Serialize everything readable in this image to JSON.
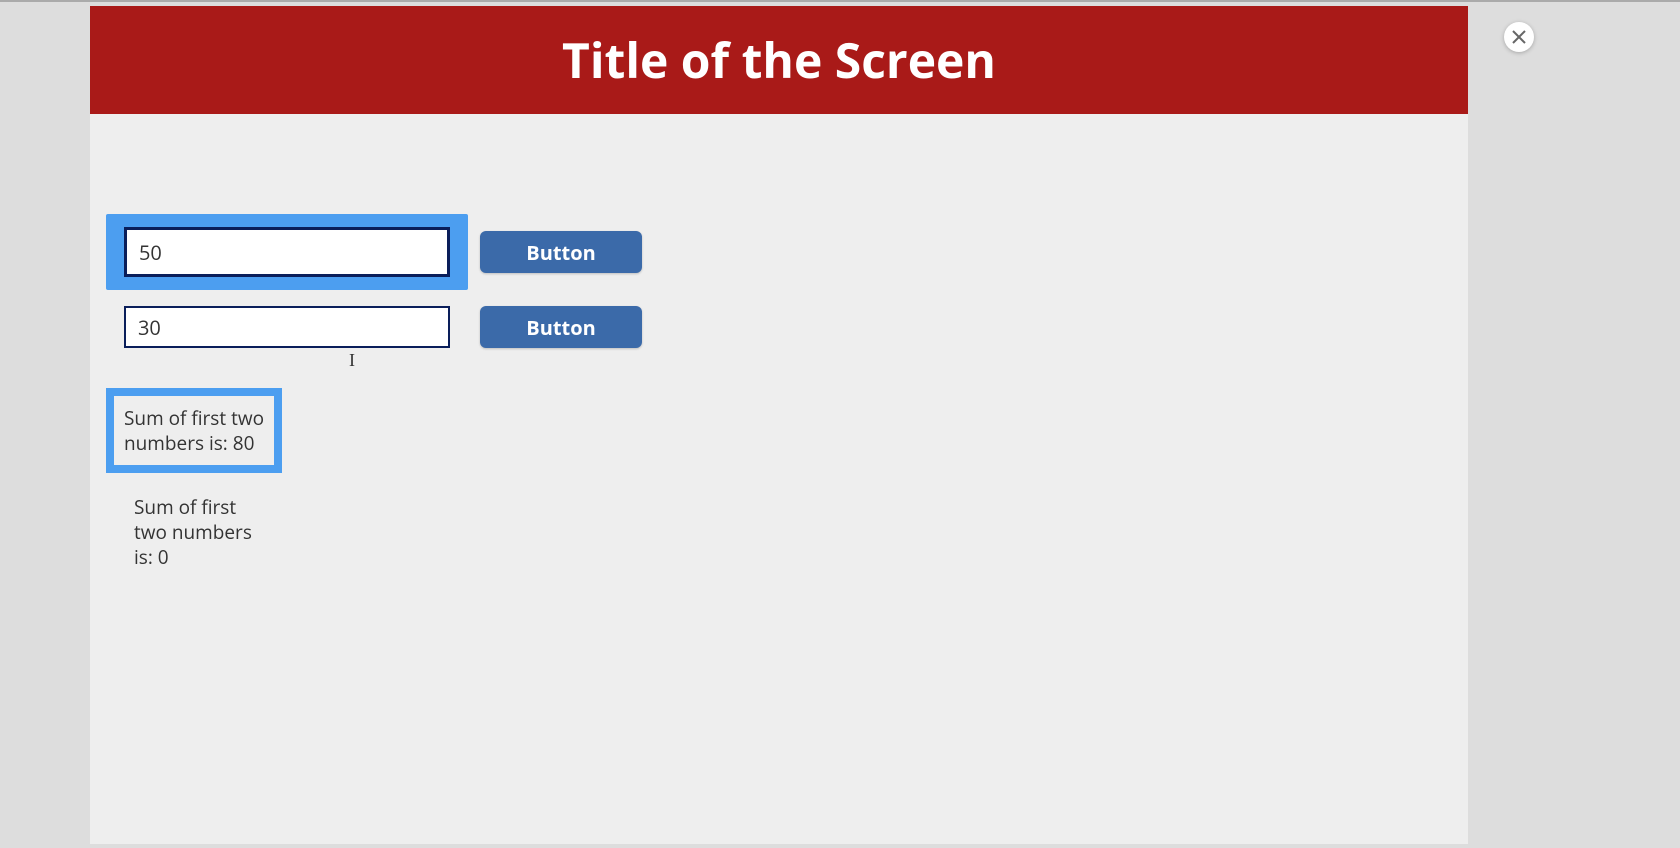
{
  "header": {
    "title": "Title of the Screen"
  },
  "inputs": {
    "first": "50",
    "second": "30"
  },
  "buttons": {
    "first_label": "Button",
    "second_label": "Button"
  },
  "results": {
    "first": "Sum of first two numbers is: 80",
    "second": "Sum of first two numbers is: 0"
  }
}
